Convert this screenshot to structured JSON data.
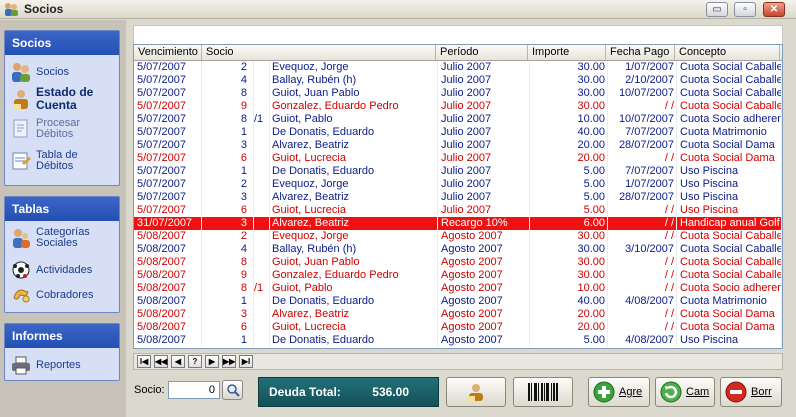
{
  "window": {
    "title": "Socios",
    "min": "▭",
    "restore": "▫",
    "close": "✕"
  },
  "sidebar": {
    "groups": [
      {
        "title": "Socios"
      },
      {
        "title": "Tablas"
      },
      {
        "title": "Informes"
      }
    ],
    "items": [
      {
        "label": "Socios",
        "icon": "people-icon"
      },
      {
        "label": "Estado de Cuenta",
        "icon": "person-account-icon"
      },
      {
        "label": "Procesar Débitos",
        "icon": "document-process-icon"
      },
      {
        "label": "Tabla de Débitos",
        "icon": "table-debits-icon"
      },
      {
        "label": "Categorías Sociales",
        "icon": "categories-icon"
      },
      {
        "label": "Actividades",
        "icon": "ball-icon"
      },
      {
        "label": "Cobradores",
        "icon": "hand-icon"
      },
      {
        "label": "Reportes",
        "icon": "printer-icon"
      }
    ]
  },
  "table": {
    "columns": [
      "Vencimiento",
      "Socio",
      "Período",
      "Importe",
      "Fecha Pago",
      "Concepto"
    ],
    "rows": [
      {
        "venc": "5/07/2007",
        "num": "2",
        "suf": "",
        "nombre": "Evequoz, Jorge",
        "periodo": "Julio 2007",
        "importe": "30.00",
        "pago": "1/07/2007",
        "concepto": "Cuota Social Caballero",
        "style": "blue"
      },
      {
        "venc": "5/07/2007",
        "num": "4",
        "suf": "",
        "nombre": "Ballay, Rubén (h)",
        "periodo": "Julio 2007",
        "importe": "30.00",
        "pago": "2/10/2007",
        "concepto": "Cuota Social Caballero",
        "style": "blue"
      },
      {
        "venc": "5/07/2007",
        "num": "8",
        "suf": "",
        "nombre": "Guiot, Juan Pablo",
        "periodo": "Julio 2007",
        "importe": "30.00",
        "pago": "10/07/2007",
        "concepto": "Cuota Social Caballero",
        "style": "blue"
      },
      {
        "venc": "5/07/2007",
        "num": "9",
        "suf": "",
        "nombre": "Gonzalez, Eduardo Pedro",
        "periodo": "Julio 2007",
        "importe": "30.00",
        "pago": "/ /",
        "concepto": "Cuota Social Caballero",
        "style": "red"
      },
      {
        "venc": "5/07/2007",
        "num": "8",
        "suf": "/1",
        "nombre": "Guiot, Pablo",
        "periodo": "Julio 2007",
        "importe": "10.00",
        "pago": "10/07/2007",
        "concepto": "Cuota Socio adherente",
        "style": "blue"
      },
      {
        "venc": "5/07/2007",
        "num": "1",
        "suf": "",
        "nombre": "De Donatis, Eduardo",
        "periodo": "Julio 2007",
        "importe": "40.00",
        "pago": "7/07/2007",
        "concepto": "Cuota Matrimonio",
        "style": "blue"
      },
      {
        "venc": "5/07/2007",
        "num": "3",
        "suf": "",
        "nombre": "Alvarez, Beatriz",
        "periodo": "Julio 2007",
        "importe": "20.00",
        "pago": "28/07/2007",
        "concepto": "Cuota Social Dama",
        "style": "blue"
      },
      {
        "venc": "5/07/2007",
        "num": "6",
        "suf": "",
        "nombre": "Guiot, Lucrecia",
        "periodo": "Julio 2007",
        "importe": "20.00",
        "pago": "/ /",
        "concepto": "Cuota Social Dama",
        "style": "red"
      },
      {
        "venc": "5/07/2007",
        "num": "1",
        "suf": "",
        "nombre": "De Donatis, Eduardo",
        "periodo": "Julio 2007",
        "importe": "5.00",
        "pago": "7/07/2007",
        "concepto": "Uso Piscina",
        "style": "blue"
      },
      {
        "venc": "5/07/2007",
        "num": "2",
        "suf": "",
        "nombre": "Evequoz, Jorge",
        "periodo": "Julio 2007",
        "importe": "5.00",
        "pago": "1/07/2007",
        "concepto": "Uso Piscina",
        "style": "blue"
      },
      {
        "venc": "5/07/2007",
        "num": "3",
        "suf": "",
        "nombre": "Alvarez, Beatriz",
        "periodo": "Julio 2007",
        "importe": "5.00",
        "pago": "28/07/2007",
        "concepto": "Uso Piscina",
        "style": "blue"
      },
      {
        "venc": "5/07/2007",
        "num": "6",
        "suf": "",
        "nombre": "Guiot, Lucrecia",
        "periodo": "Julio 2007",
        "importe": "5.00",
        "pago": "/ /",
        "concepto": "Uso Piscina",
        "style": "red"
      },
      {
        "venc": "31/07/2007",
        "num": "3",
        "suf": "",
        "nombre": "Alvarez, Beatriz",
        "periodo": "Recargo 10%",
        "importe": "6.00",
        "pago": "/ /",
        "concepto": "Handicap anual Golf D",
        "style": "sel"
      },
      {
        "venc": "5/08/2007",
        "num": "2",
        "suf": "",
        "nombre": "Evequoz, Jorge",
        "periodo": "Agosto 2007",
        "importe": "30.00",
        "pago": "/ /",
        "concepto": "Cuota Social Caballero",
        "style": "red"
      },
      {
        "venc": "5/08/2007",
        "num": "4",
        "suf": "",
        "nombre": "Ballay, Rubén (h)",
        "periodo": "Agosto 2007",
        "importe": "30.00",
        "pago": "3/10/2007",
        "concepto": "Cuota Social Caballero",
        "style": "blue"
      },
      {
        "venc": "5/08/2007",
        "num": "8",
        "suf": "",
        "nombre": "Guiot, Juan Pablo",
        "periodo": "Agosto 2007",
        "importe": "30.00",
        "pago": "/ /",
        "concepto": "Cuota Social Caballero",
        "style": "red"
      },
      {
        "venc": "5/08/2007",
        "num": "9",
        "suf": "",
        "nombre": "Gonzalez, Eduardo Pedro",
        "periodo": "Agosto 2007",
        "importe": "30.00",
        "pago": "/ /",
        "concepto": "Cuota Social Caballero",
        "style": "red"
      },
      {
        "venc": "5/08/2007",
        "num": "8",
        "suf": "/1",
        "nombre": "Guiot, Pablo",
        "periodo": "Agosto 2007",
        "importe": "10.00",
        "pago": "/ /",
        "concepto": "Cuota Socio adherente",
        "style": "red"
      },
      {
        "venc": "5/08/2007",
        "num": "1",
        "suf": "",
        "nombre": "De Donatis, Eduardo",
        "periodo": "Agosto 2007",
        "importe": "40.00",
        "pago": "4/08/2007",
        "concepto": "Cuota Matrimonio",
        "style": "blue"
      },
      {
        "venc": "5/08/2007",
        "num": "3",
        "suf": "",
        "nombre": "Alvarez, Beatriz",
        "periodo": "Agosto 2007",
        "importe": "20.00",
        "pago": "/ /",
        "concepto": "Cuota Social Dama",
        "style": "red"
      },
      {
        "venc": "5/08/2007",
        "num": "6",
        "suf": "",
        "nombre": "Guiot, Lucrecia",
        "periodo": "Agosto 2007",
        "importe": "20.00",
        "pago": "/ /",
        "concepto": "Cuota Social Dama",
        "style": "red"
      },
      {
        "venc": "5/08/2007",
        "num": "1",
        "suf": "",
        "nombre": "De Donatis, Eduardo",
        "periodo": "Agosto 2007",
        "importe": "5.00",
        "pago": "4/08/2007",
        "concepto": "Uso Piscina",
        "style": "blue"
      }
    ]
  },
  "navigator": {
    "buttons": [
      "I◀",
      "◀◀",
      "◀",
      "?",
      "▶",
      "▶▶",
      "▶I"
    ]
  },
  "footer": {
    "socio_label": "Socio:",
    "socio_value": "0",
    "deuda_label": "Deuda Total:",
    "deuda_value": "536.00",
    "agregar_label": "Agre",
    "cambiar_label": "Cam",
    "borrar_label": "Borr"
  },
  "colors": {
    "accent": "#2350b4",
    "debt_row": "#d00000",
    "paid_row": "#0a1c8a",
    "selected": "#ee1111",
    "deuda_panel": "#1c6168"
  }
}
